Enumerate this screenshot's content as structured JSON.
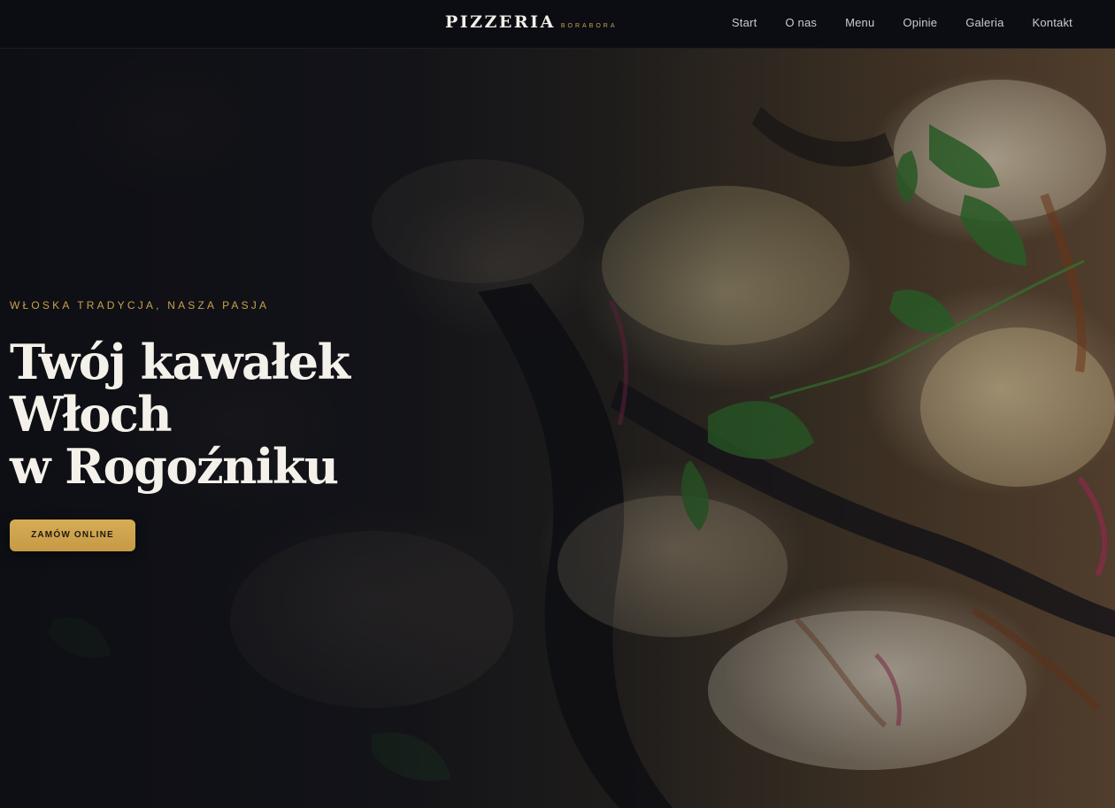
{
  "header": {
    "logo_main": "PIZZERIA",
    "logo_sub": "BORABORA",
    "nav": [
      {
        "label": "Start"
      },
      {
        "label": "O nas"
      },
      {
        "label": "Menu"
      },
      {
        "label": "Opinie"
      },
      {
        "label": "Galeria"
      },
      {
        "label": "Kontakt"
      }
    ]
  },
  "hero": {
    "eyebrow": "WŁOSKA TRADYCJA, NASZA PASJA",
    "headline_lines": [
      "Twój kawałek",
      "Włoch",
      "w Rogoźniku"
    ],
    "cta_label": "ZAMÓW ONLINE",
    "background_image": "pizza-closeup-photo"
  },
  "colors": {
    "accent_gold": "#c9a24a",
    "header_bg": "#0b0d13",
    "headline_text": "#f4f1ea",
    "nav_text": "#c9ccd3"
  }
}
